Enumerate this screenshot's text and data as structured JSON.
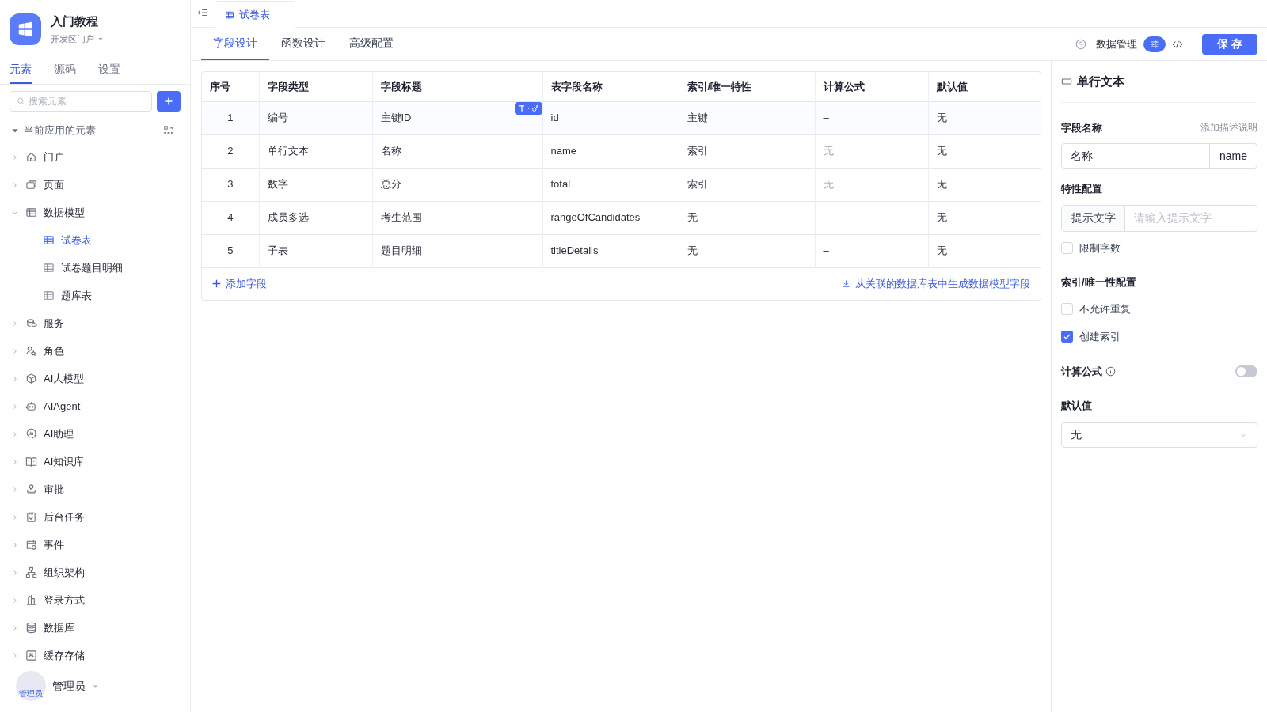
{
  "app": {
    "title": "入门教程",
    "portal": "开发区门户"
  },
  "sidebar": {
    "tabs": [
      {
        "label": "元素",
        "selected": true
      },
      {
        "label": "源码",
        "selected": false
      },
      {
        "label": "设置",
        "selected": false
      }
    ],
    "search": {
      "placeholder": "搜索元素"
    },
    "section": {
      "label": "当前应用的元素",
      "expanded": true
    },
    "items": [
      {
        "label": "门户",
        "expanded": false,
        "selected": false
      },
      {
        "label": "页面",
        "expanded": false,
        "selected": false
      },
      {
        "label": "数据模型",
        "expanded": true,
        "selected": false,
        "children": [
          {
            "label": "试卷表",
            "selected": true
          },
          {
            "label": "试卷题目明细",
            "selected": false
          },
          {
            "label": "题库表",
            "selected": false
          }
        ]
      },
      {
        "label": "服务",
        "expanded": false,
        "selected": false
      },
      {
        "label": "角色",
        "expanded": false,
        "selected": false
      },
      {
        "label": "AI大模型",
        "expanded": false,
        "selected": false
      },
      {
        "label": "AIAgent",
        "expanded": false,
        "selected": false
      },
      {
        "label": "AI助理",
        "expanded": false,
        "selected": false
      },
      {
        "label": "AI知识库",
        "expanded": false,
        "selected": false
      },
      {
        "label": "审批",
        "expanded": false,
        "selected": false
      },
      {
        "label": "后台任务",
        "expanded": false,
        "selected": false
      },
      {
        "label": "事件",
        "expanded": false,
        "selected": false
      },
      {
        "label": "组织架构",
        "expanded": false,
        "selected": false
      },
      {
        "label": "登录方式",
        "expanded": false,
        "selected": false
      },
      {
        "label": "数据库",
        "expanded": false,
        "selected": false
      },
      {
        "label": "缓存存储",
        "expanded": false,
        "selected": false
      }
    ],
    "user": {
      "avatar_label": "管理员",
      "name": "管理员"
    }
  },
  "editor_tabs": [
    {
      "label": "试卷表",
      "selected": true
    }
  ],
  "tabs": [
    {
      "label": "字段设计",
      "selected": true
    },
    {
      "label": "函数设计",
      "selected": false
    },
    {
      "label": "高级配置",
      "selected": false
    }
  ],
  "toolbar": {
    "data_manage": "数据管理",
    "save": "保 存"
  },
  "table": {
    "columns": [
      "序号",
      "字段类型",
      "字段标题",
      "表字段名称",
      "索引/唯一特性",
      "计算公式",
      "默认值"
    ],
    "rows": [
      {
        "cells": [
          "1",
          "编号",
          "主键ID",
          "id",
          "主键",
          "–",
          "无"
        ],
        "formula_muted": false,
        "hovered": true
      },
      {
        "cells": [
          "2",
          "单行文本",
          "名称",
          "name",
          "索引",
          "无",
          "无"
        ],
        "formula_muted": true,
        "hovered": false
      },
      {
        "cells": [
          "3",
          "数字",
          "总分",
          "total",
          "索引",
          "无",
          "无"
        ],
        "formula_muted": true,
        "hovered": false
      },
      {
        "cells": [
          "4",
          "成员多选",
          "考生范围",
          "rangeOfCandidates",
          "无",
          "–",
          "无"
        ],
        "formula_muted": false,
        "hovered": false
      },
      {
        "cells": [
          "5",
          "子表",
          "题目明细",
          "titleDetails",
          "无",
          "–",
          "无"
        ],
        "formula_muted": false,
        "hovered": false
      }
    ],
    "add_field": "添加字段",
    "generate": "从关联的数据库表中生成数据模型字段"
  },
  "panel": {
    "title": "单行文本",
    "field_name": {
      "label": "字段名称",
      "link": "添加描述说明",
      "value": "名称",
      "key": "name"
    },
    "traits": {
      "label": "特性配置",
      "hint_label": "提示文字",
      "hint_placeholder": "请输入提示文字",
      "limit": {
        "label": "限制字数",
        "checked": false
      }
    },
    "index": {
      "label": "索引/唯一性配置",
      "options": [
        {
          "label": "不允许重复",
          "checked": false
        },
        {
          "label": "创建索引",
          "checked": true
        }
      ]
    },
    "formula": {
      "label": "计算公式",
      "on": false
    },
    "default": {
      "label": "默认值",
      "value": "无"
    }
  }
}
